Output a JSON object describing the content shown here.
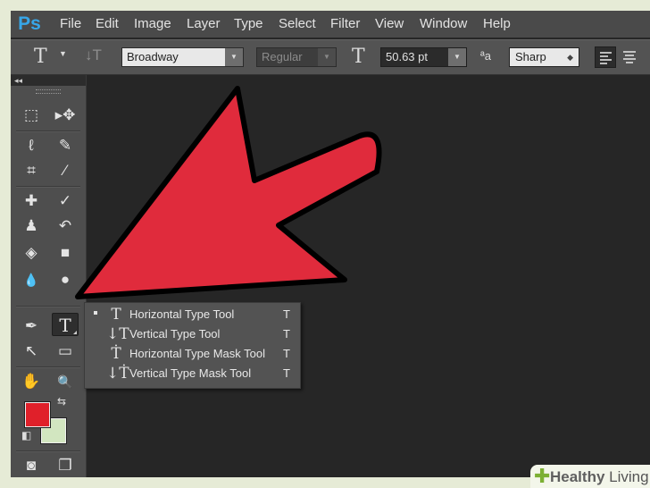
{
  "app": {
    "logo": "Ps",
    "accent": "#37a6e8"
  },
  "menu": [
    "File",
    "Edit",
    "Image",
    "Layer",
    "Type",
    "Select",
    "Filter",
    "View",
    "Window",
    "Help"
  ],
  "options": {
    "tool_glyph": "T",
    "orientation_glyph": "↓T",
    "font_family": "Broadway",
    "font_style": "Regular",
    "size_glyph": "T",
    "font_size": "50.63 pt",
    "aa_glyph": "ªa",
    "anti_alias": "Sharp"
  },
  "toolbar": {
    "collapse_glyph": "◂◂",
    "tools": [
      {
        "name": "marquee-tool-icon",
        "glyph": "⬚"
      },
      {
        "name": "move-tool-icon",
        "glyph": "▸✥"
      },
      {
        "name": "lasso-tool-icon",
        "glyph": "ℓ"
      },
      {
        "name": "quick-selection-tool-icon",
        "glyph": "✎"
      },
      {
        "name": "crop-tool-icon",
        "glyph": "⌗"
      },
      {
        "name": "eyedropper-tool-icon",
        "glyph": "⁄"
      },
      {
        "name": "healing-brush-tool-icon",
        "glyph": "✚"
      },
      {
        "name": "brush-tool-icon",
        "glyph": "✓"
      },
      {
        "name": "clone-stamp-tool-icon",
        "glyph": "♟"
      },
      {
        "name": "history-brush-tool-icon",
        "glyph": "↶"
      },
      {
        "name": "eraser-tool-icon",
        "glyph": "◈"
      },
      {
        "name": "gradient-tool-icon",
        "glyph": "■"
      },
      {
        "name": "blur-tool-icon",
        "glyph": "💧"
      },
      {
        "name": "dodge-tool-icon",
        "glyph": "●"
      },
      {
        "name": "pen-tool-icon",
        "glyph": "✒"
      },
      {
        "name": "type-tool-icon",
        "glyph": "T"
      },
      {
        "name": "path-selection-tool-icon",
        "glyph": "↖"
      },
      {
        "name": "rectangle-tool-icon",
        "glyph": "▭"
      },
      {
        "name": "hand-tool-icon",
        "glyph": "✋"
      },
      {
        "name": "zoom-tool-icon",
        "glyph": "🔍"
      },
      {
        "name": "quick-mask-icon",
        "glyph": "◙"
      },
      {
        "name": "screen-mode-icon",
        "glyph": "❐"
      }
    ],
    "swap_glyph": "⇆",
    "default_glyph": "◧",
    "colors": {
      "foreground": "#e0202a",
      "background": "#d2e6c0"
    }
  },
  "flyout": {
    "items": [
      {
        "icon": "T",
        "label": "Horizontal Type Tool",
        "key": "T",
        "selected": true
      },
      {
        "icon": "↓T",
        "label": "Vertical Type Tool",
        "key": "T",
        "selected": false
      },
      {
        "icon": "Ṫ",
        "label": "Horizontal Type Mask Tool",
        "key": "T",
        "selected": false
      },
      {
        "icon": "↓Ṫ",
        "label": "Vertical Type Mask Tool",
        "key": "T",
        "selected": false
      }
    ]
  },
  "annotation": {
    "arrow_color": "#e02b3c"
  },
  "watermark": {
    "prefix": "Healthy",
    "suffix": "Living",
    "brand_color": "#7cb034"
  }
}
